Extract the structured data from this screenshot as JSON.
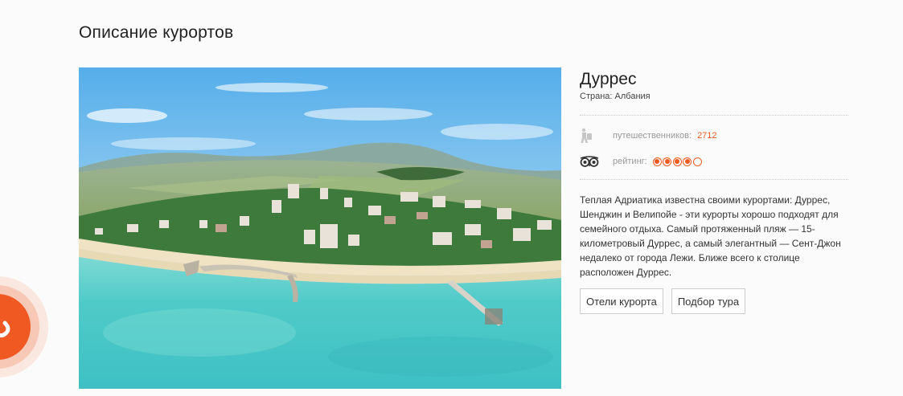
{
  "section": {
    "title": "Описание курортов"
  },
  "resort": {
    "name": "Дуррес",
    "country": "Страна: Албания",
    "travelers_label": "путешественников:",
    "travelers_value": "2712",
    "rating_label": "рейтинг:",
    "rating": {
      "value": 4,
      "max": 5
    },
    "description": "Теплая Адриатика известна своими курортами: Дуррес, Шенджин и Велипойе - эти курорты хорошо подходят для семейного отдыха. Самый протяженный пляж — 15-километровый Дуррес, а самый элегантный — Сент-Джон недалеко от города Лежи. Ближе всего к столице расположен Дуррес."
  },
  "buttons": {
    "hotels": "Отели курорта",
    "tour": "Подбор тура"
  },
  "icons": {
    "travelers": "traveler-icon",
    "rating": "tripadvisor-owl-icon",
    "call": "phone-icon"
  },
  "colors": {
    "accent": "#f05a22",
    "sea": "#4cc4c4",
    "sky": "#7fc3ef"
  }
}
